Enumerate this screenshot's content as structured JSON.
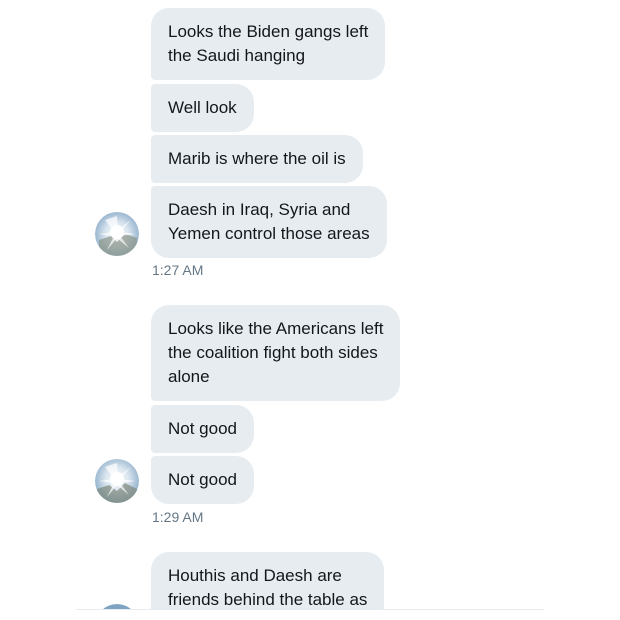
{
  "conversation": {
    "groups": [
      {
        "messages": [
          "Looks the Biden gangs left\nthe Saudi hanging",
          "Well look",
          "Marib is where the oil is",
          "Daesh in Iraq, Syria and\nYemen control those areas"
        ],
        "timestamp": "1:27 AM"
      },
      {
        "messages": [
          "Looks like the Americans left\nthe coalition fight both sides\nalone",
          "Not good",
          "Not good"
        ],
        "timestamp": "1:29 AM"
      },
      {
        "messages": [
          "Houthis and Daesh are\nfriends behind the table as"
        ]
      }
    ]
  },
  "colors": {
    "bubble": "#e6ecf0",
    "text": "#14171a",
    "timestamp": "#657786",
    "avatar_accent": "#9ab8d4"
  },
  "icons": {
    "avatar": "sender-avatar-icon"
  }
}
